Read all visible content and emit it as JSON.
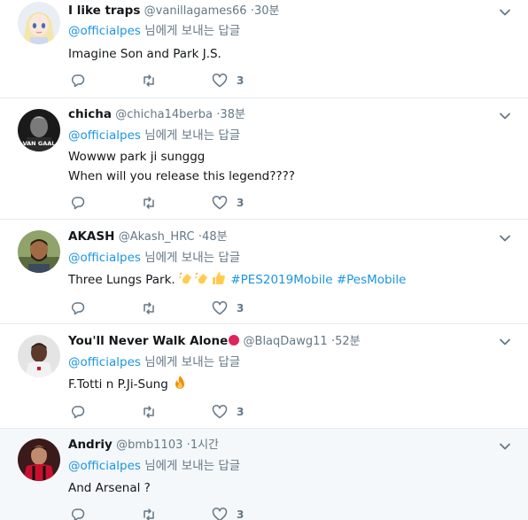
{
  "replying_suffix": "님에게 보내는 답글",
  "tweets": [
    {
      "name": "I like traps",
      "handle": "@vanillagames66",
      "time": "30분",
      "reply_to": "@officialpes",
      "lines": [
        "Imagine Son and Park J.S."
      ],
      "likes": "3",
      "avatar": "anime-avatar"
    },
    {
      "name": "chicha",
      "handle": "@chicha14berba",
      "time": "38분",
      "reply_to": "@officialpes",
      "lines": [
        "Wowww park ji sunggg",
        "When will you release this legend????"
      ],
      "likes": "3",
      "avatar": "van-gaal-avatar",
      "avatar_text": "VAN GAAL"
    },
    {
      "name": "AKASH",
      "handle": "@Akash_HRC",
      "time": "48분",
      "reply_to": "@officialpes",
      "text_plain": "Three Lungs Park. ",
      "hashtags": [
        "#PES2019Mobile",
        "#PesMobile"
      ],
      "likes": "3",
      "avatar": "bearded-man-avatar"
    },
    {
      "name": "You'll Never Walk Alone",
      "handle": "@BlaqDawg11",
      "time": "52분",
      "reply_to": "@officialpes",
      "lines": [
        "F.Totti n P.Ji-Sung "
      ],
      "likes": "3",
      "avatar": "footballer-avatar"
    },
    {
      "name": "Andriy",
      "handle": "@bmb1103",
      "time": "1시간",
      "reply_to": "@officialpes",
      "lines": [
        "And Arsenal ?"
      ],
      "likes": "3",
      "avatar": "red-jersey-avatar"
    }
  ],
  "colors": {
    "link": "#1b95e0",
    "muted": "#657786",
    "text": "#14171a",
    "divider": "#e6ecf0",
    "highlight_bg": "#f5f8fa"
  }
}
